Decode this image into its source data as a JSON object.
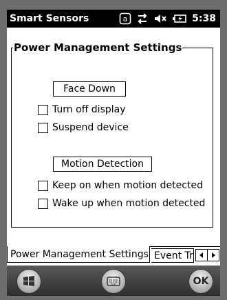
{
  "titlebar": {
    "title": "Smart Sensors",
    "time": "5:38",
    "icons": [
      "input-mode-icon",
      "data-connection-icon",
      "volume-muted-icon",
      "battery-charging-icon"
    ]
  },
  "groupbox": {
    "title": "Power Management Settings"
  },
  "face_down": {
    "label": "Face Down",
    "options": [
      {
        "label": "Turn off display",
        "checked": false
      },
      {
        "label": "Suspend device",
        "checked": false
      }
    ]
  },
  "motion_detection": {
    "label": "Motion Detection",
    "options": [
      {
        "label": "Keep on when motion detected",
        "checked": false
      },
      {
        "label": "Wake up when motion detected",
        "checked": false
      }
    ]
  },
  "tabs": [
    {
      "label": "Power Management Settings",
      "active": true
    },
    {
      "label": "Event Tr",
      "active": false
    }
  ],
  "softkeys": {
    "start_icon": "windows-logo-icon",
    "keyboard_icon": "keyboard-icon",
    "ok_label": "OK"
  }
}
